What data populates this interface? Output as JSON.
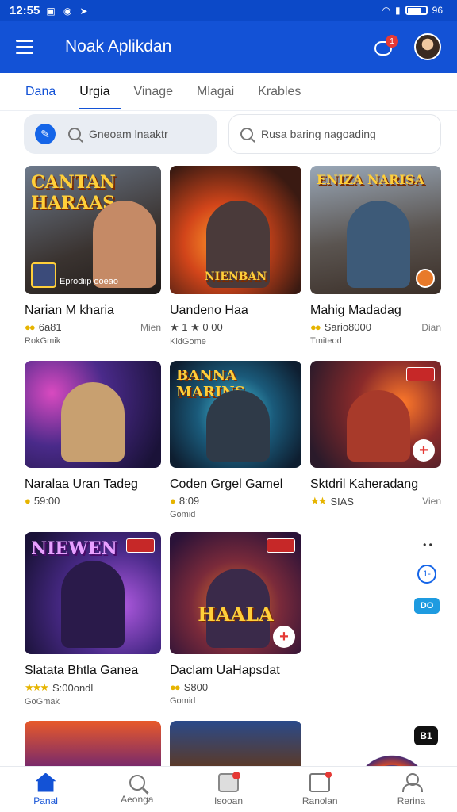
{
  "status_bar": {
    "time": "12:55",
    "battery": "96"
  },
  "app_bar": {
    "title": "Noak Aplikdan",
    "notification_count": "1"
  },
  "tabs": [
    {
      "label": "Dana"
    },
    {
      "label": "Urgia"
    },
    {
      "label": "Vinage"
    },
    {
      "label": "Mlagai"
    },
    {
      "label": "Krables"
    }
  ],
  "search": {
    "primary_placeholder": "Gneoam lnaaktr",
    "secondary_placeholder": "Rusa baring nagoading"
  },
  "cards": [
    {
      "banner": "CANTAN HARAAS",
      "caption": "Eprodiip ooeao",
      "title": "Narian M kharia",
      "rating": "6a81",
      "extra": "Mien",
      "sub": "RokGmik"
    },
    {
      "banner": "NIENBAN",
      "caption": "",
      "title": "Uandeno Haa",
      "rating": "★ 1 ★ 0 00",
      "extra": "",
      "sub": "KidGome"
    },
    {
      "banner": "ENIZA NARISA",
      "caption": "",
      "title": "Mahig Madadag",
      "rating": "Sario8000",
      "extra": "Dian",
      "sub": "Tmiteod"
    },
    {
      "banner": "",
      "caption": "",
      "title": "Naralaa Uran Tadeg",
      "rating": "59:00",
      "extra": "",
      "sub": ""
    },
    {
      "banner": "BANNA MARINS",
      "caption": "",
      "title": "Coden Grgel Gamel",
      "rating": "8:09",
      "extra": "",
      "sub": "Gomid"
    },
    {
      "banner": "",
      "caption": "",
      "title": "Sktdril Kaheradang",
      "rating": "SIAS",
      "extra": "Vien",
      "sub": ""
    },
    {
      "banner": "NIEWEN",
      "caption": "",
      "title": "Slatata Bhtla Ganea",
      "rating": "S:00ondl",
      "extra": "",
      "sub": "GoGmak"
    },
    {
      "banner": "HAALA",
      "caption": "",
      "title": "Daclam UaHapsdat",
      "rating": "S800",
      "extra": "",
      "sub": "Gomid"
    }
  ],
  "side_controls": {
    "a": "• •",
    "b": "1-",
    "c": "DO"
  },
  "float_button": "B1",
  "bottom_nav": [
    {
      "label": "Panal"
    },
    {
      "label": "Aeonga"
    },
    {
      "label": "Isooan"
    },
    {
      "label": "Ranolan"
    },
    {
      "label": "Rerina"
    }
  ]
}
